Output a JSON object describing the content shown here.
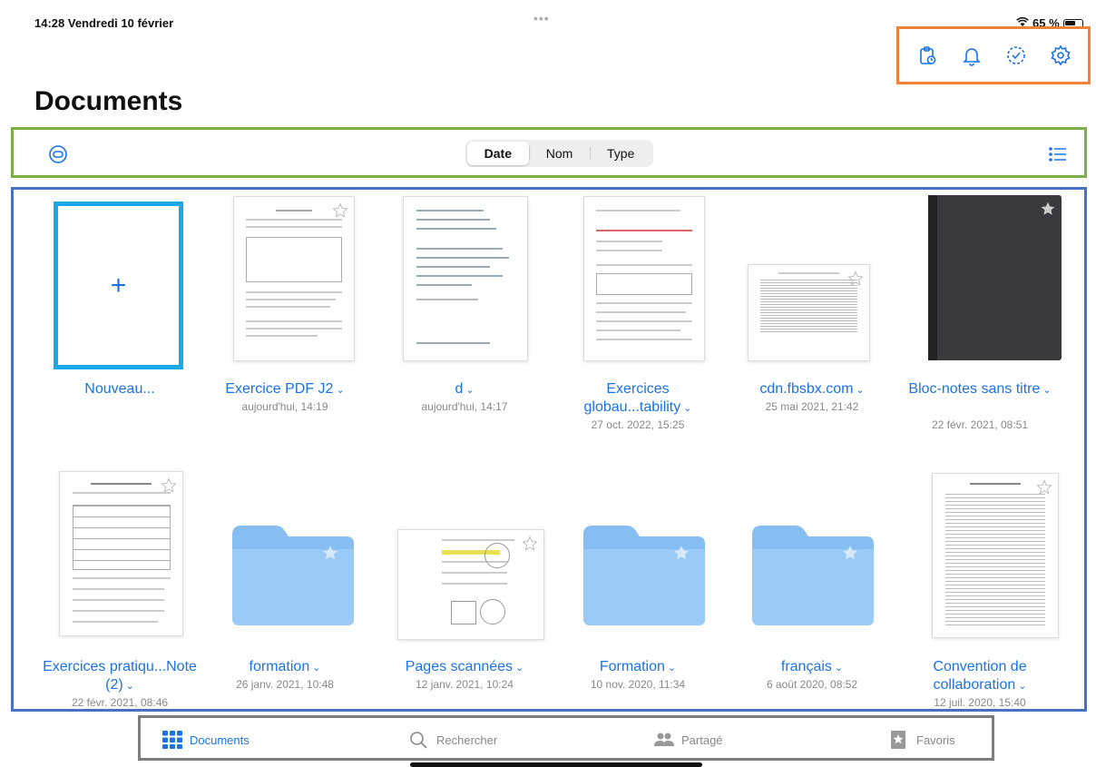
{
  "status": {
    "time_date": "14:28  Vendredi 10 février",
    "battery": "65 %"
  },
  "page": {
    "title": "Documents"
  },
  "sort": {
    "options": [
      "Date",
      "Nom",
      "Type"
    ],
    "selected": "Date"
  },
  "items": [
    {
      "name": "Nouveau...",
      "date": ""
    },
    {
      "name": "Exercice PDF J2",
      "date": "aujourd'hui, 14:19"
    },
    {
      "name": "d",
      "date": "aujourd'hui, 14:17"
    },
    {
      "name": "Exercices globau...tability",
      "date": "27 oct. 2022, 15:25"
    },
    {
      "name": "cdn.fbsbx.com",
      "date": "25 mai 2021, 21:42"
    },
    {
      "name": "Bloc-notes sans titre",
      "date": "22 févr. 2021, 08:51"
    },
    {
      "name": "Exercices pratiqu...Note (2)",
      "date": "22 févr. 2021, 08:46"
    },
    {
      "name": "formation",
      "date": "26 janv. 2021, 10:48"
    },
    {
      "name": "Pages scannées",
      "date": "12 janv. 2021, 10:24"
    },
    {
      "name": "Formation",
      "date": "10 nov. 2020, 11:34"
    },
    {
      "name": "français",
      "date": "6 août 2020, 08:52"
    },
    {
      "name": "Convention de collaboration",
      "date": "12 juil. 2020, 15:40"
    }
  ],
  "tabs": [
    {
      "label": "Documents",
      "icon": "grid-icon"
    },
    {
      "label": "Rechercher",
      "icon": "search-icon"
    },
    {
      "label": "Partagé",
      "icon": "people-icon"
    },
    {
      "label": "Favoris",
      "icon": "star-icon"
    }
  ],
  "colors": {
    "accent": "#1a73e8",
    "folder": "#86bdf2",
    "orange": "#f0833a",
    "green": "#7caf44",
    "blue": "#4672c4",
    "cyan": "#1aa8e8"
  }
}
